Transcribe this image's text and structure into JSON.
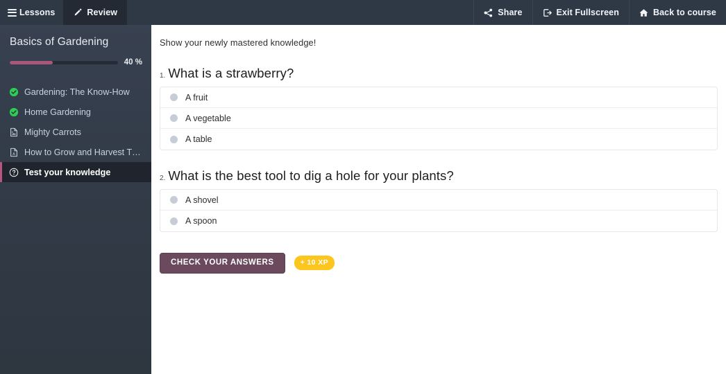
{
  "topbar": {
    "left_items": [
      {
        "label": "Lessons",
        "icon": "hamburger-icon",
        "active": false
      },
      {
        "label": "Review",
        "icon": "pencil-icon",
        "active": true
      }
    ],
    "right_items": [
      {
        "label": "Share",
        "icon": "share-icon"
      },
      {
        "label": "Exit Fullscreen",
        "icon": "exit-fullscreen-icon"
      },
      {
        "label": "Back to course",
        "icon": "home-icon"
      }
    ]
  },
  "sidebar": {
    "course_title": "Basics of Gardening",
    "progress": {
      "percent": 40,
      "label": "40 %",
      "fill_color": "#a9587b",
      "track_color": "#262c36"
    },
    "lessons": [
      {
        "label": "Gardening: The Know-How",
        "icon": "check-circle-icon",
        "state": "completed"
      },
      {
        "label": "Home Gardening",
        "icon": "check-circle-icon",
        "state": "completed"
      },
      {
        "label": "Mighty Carrots",
        "icon": "image-file-icon",
        "state": "default"
      },
      {
        "label": "How to Grow and Harvest The B…",
        "icon": "pdf-file-icon",
        "state": "default"
      },
      {
        "label": "Test your knowledge",
        "icon": "question-circle-icon",
        "state": "current"
      }
    ],
    "accent_color": "#b4567f"
  },
  "main": {
    "intro": "Show your newly mastered knowledge!",
    "questions": [
      {
        "number": "1.",
        "text": "What is a strawberry?",
        "options": [
          "A fruit",
          "A vegetable",
          "A table"
        ]
      },
      {
        "number": "2.",
        "text": "What is the best tool to dig a hole for your plants?",
        "options": [
          "A shovel",
          "A spoon"
        ]
      }
    ],
    "check_button": "CHECK YOUR ANSWERS",
    "xp_badge": "+ 10 XP",
    "button_color": "#6b4a5e",
    "xp_color": "#fcc61e"
  }
}
